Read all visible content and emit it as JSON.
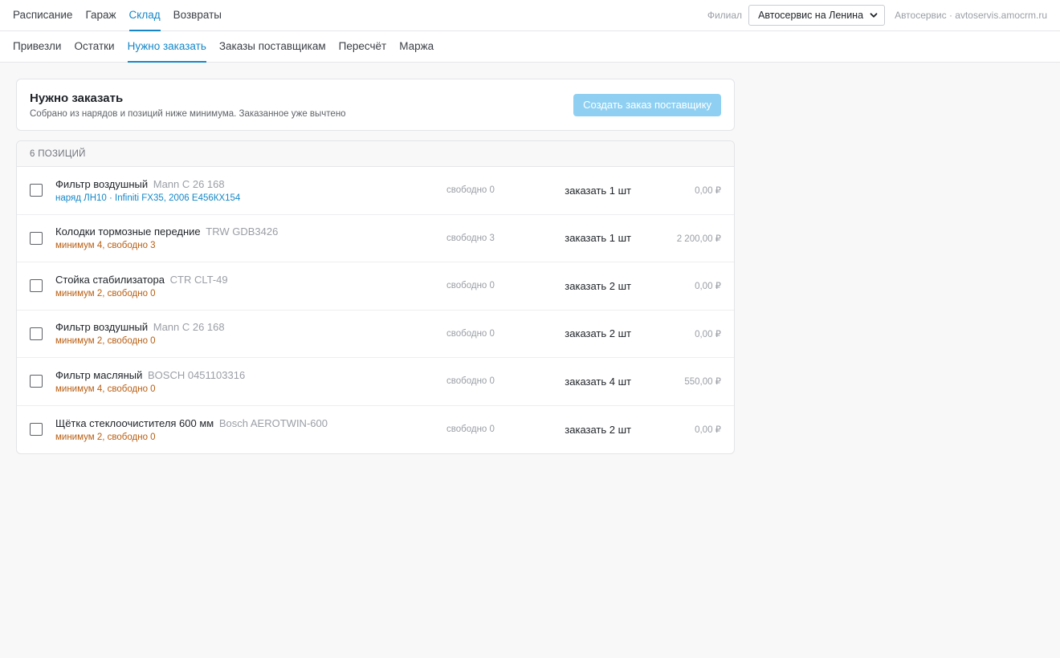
{
  "topnav": {
    "items": [
      {
        "label": "Расписание",
        "active": false
      },
      {
        "label": "Гараж",
        "active": false
      },
      {
        "label": "Склад",
        "active": true
      },
      {
        "label": "Возвраты",
        "active": false
      }
    ],
    "branch_label": "Филиал",
    "branch_value": "Автосервис на Ленина",
    "account": "Автосервис · avtoservis.amocrm.ru"
  },
  "subnav": {
    "items": [
      {
        "label": "Привезли",
        "active": false
      },
      {
        "label": "Остатки",
        "active": false
      },
      {
        "label": "Нужно заказать",
        "active": true
      },
      {
        "label": "Заказы поставщикам",
        "active": false
      },
      {
        "label": "Пересчёт",
        "active": false
      },
      {
        "label": "Маржа",
        "active": false
      }
    ]
  },
  "header": {
    "title": "Нужно заказать",
    "subtitle": "Собрано из нарядов и позиций ниже минимума. Заказанное уже вычтено",
    "create_button": "Создать заказ поставщику"
  },
  "list": {
    "count_label": "6 позиций",
    "rows": [
      {
        "name": "Фильтр воздушный",
        "code": "Mann C 26 168",
        "meta": "наряд ЛН10 · Infiniti FX35, 2006 Е456КХ154",
        "meta_kind": "blue",
        "free": "свободно 0",
        "order": "заказать 1 шт",
        "price": "0,00 ₽",
        "checked": false
      },
      {
        "name": "Колодки тормозные передние",
        "code": "TRW GDB3426",
        "meta": "минимум 4, свободно 3",
        "meta_kind": "orange",
        "free": "свободно 3",
        "order": "заказать 1 шт",
        "price": "2 200,00 ₽",
        "checked": false
      },
      {
        "name": "Стойка стабилизатора",
        "code": "CTR CLT-49",
        "meta": "минимум 2, свободно 0",
        "meta_kind": "orange",
        "free": "свободно 0",
        "order": "заказать 2 шт",
        "price": "0,00 ₽",
        "checked": false
      },
      {
        "name": "Фильтр воздушный",
        "code": "Mann C 26 168",
        "meta": "минимум 2, свободно 0",
        "meta_kind": "orange",
        "free": "свободно 0",
        "order": "заказать 2 шт",
        "price": "0,00 ₽",
        "checked": false
      },
      {
        "name": "Фильтр масляный",
        "code": "BOSCH 0451103316",
        "meta": "минимум 4, свободно 0",
        "meta_kind": "orange",
        "free": "свободно 0",
        "order": "заказать 4 шт",
        "price": "550,00 ₽",
        "checked": false
      },
      {
        "name": "Щётка стеклоочистителя 600 мм",
        "code": "Bosch AEROTWIN-600",
        "meta": "минимум 2, свободно 0",
        "meta_kind": "orange",
        "free": "свободно 0",
        "order": "заказать 2 шт",
        "price": "0,00 ₽",
        "checked": false
      }
    ]
  },
  "colors": {
    "accent": "#1587c8",
    "warning": "#b85d10",
    "button_disabled": "#8fd0f2"
  },
  "icons": {
    "branch_dropdown": "chevron-down-icon"
  }
}
